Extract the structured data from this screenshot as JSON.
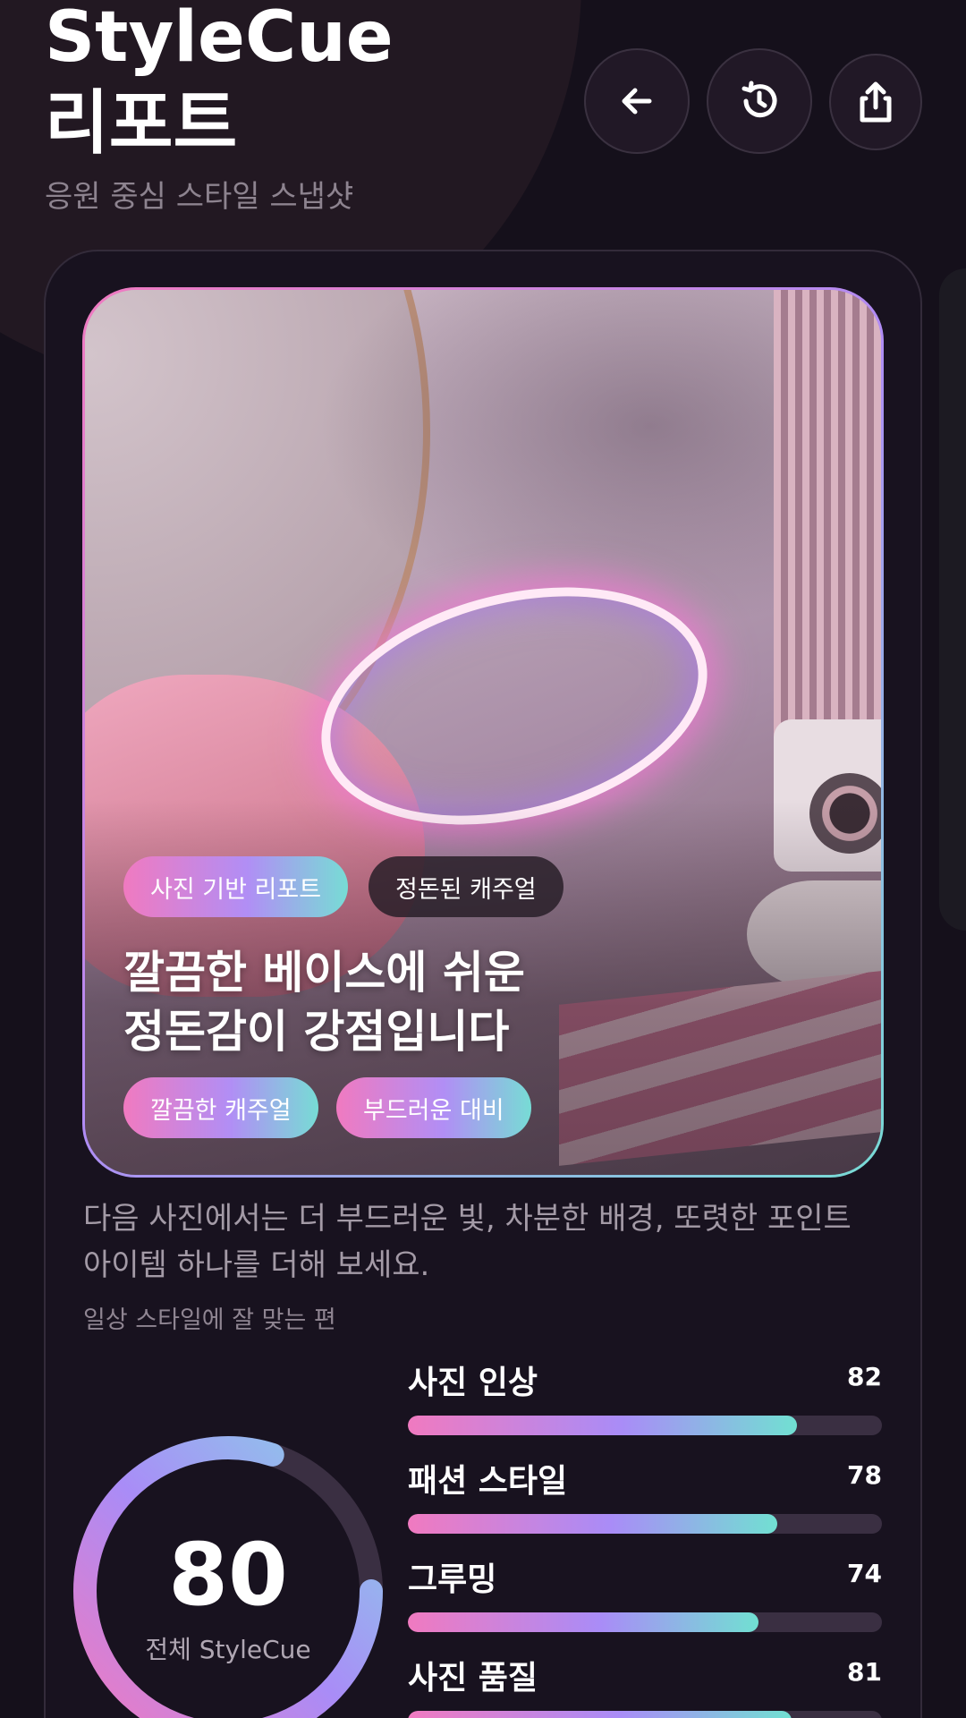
{
  "header": {
    "title_line1": "StyleCue",
    "title_line2": "리포트",
    "subtitle": "응원 중심 스타일 스냅샷",
    "buttons": [
      "back-arrow-icon",
      "history-icon",
      "share-icon"
    ]
  },
  "hero": {
    "badges": [
      "사진 기반 리포트",
      "정돈된 캐주얼"
    ],
    "headline_line1": "깔끔한 베이스에 쉬운",
    "headline_line2": "정돈감이 강점입니다",
    "tags": [
      "깔끔한 캐주얼",
      "부드러운 대비"
    ]
  },
  "advice": "다음 사진에서는 더 부드러운 빛, 차분한 배경, 또렷한 포인트 아이템 하나를 더해 보세요.",
  "fit_note": "일상 스타일에 잘 맞는 편",
  "overall": {
    "score": "80",
    "label": "전체 StyleCue",
    "fraction": 0.8
  },
  "metrics": [
    {
      "label": "사진 인상",
      "value": "82",
      "fraction": 0.82
    },
    {
      "label": "패션 스타일",
      "value": "78",
      "fraction": 0.78
    },
    {
      "label": "그루밍",
      "value": "74",
      "fraction": 0.74
    },
    {
      "label": "사진 품질",
      "value": "81",
      "fraction": 0.81
    }
  ],
  "colors": {
    "background": "#15101b",
    "card": "#18121f",
    "accent_pink": "#f07ac0",
    "accent_purple": "#a98cf7",
    "accent_teal": "#71e0d2",
    "track": "#3a2f42"
  }
}
